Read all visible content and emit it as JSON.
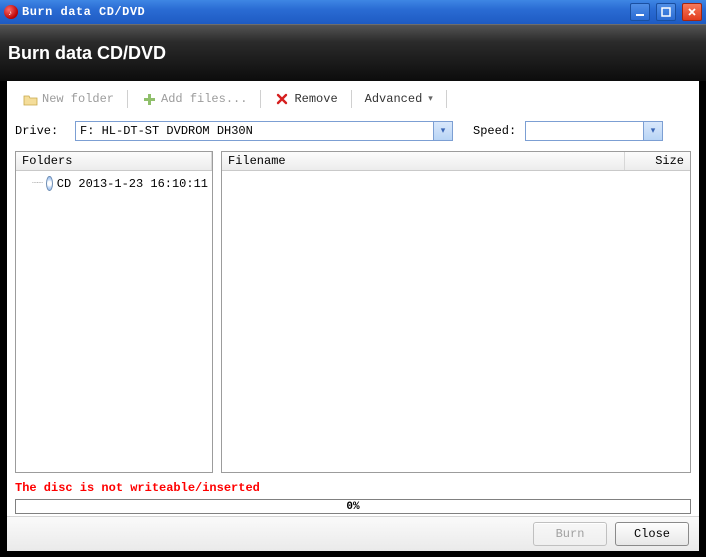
{
  "title": "Burn data CD/DVD",
  "header": {
    "heading": "Burn data CD/DVD"
  },
  "toolbar": {
    "new_folder": "New folder",
    "add_files": "Add files...",
    "remove": "Remove",
    "advanced": "Advanced"
  },
  "drives": {
    "drive_label": "Drive:",
    "drive_value": "F: HL-DT-ST DVDROM DH30N",
    "speed_label": "Speed:",
    "speed_value": ""
  },
  "folders_pane": {
    "header": "Folders",
    "items": [
      {
        "label": "CD 2013-1-23 16:10:11"
      }
    ]
  },
  "files_pane": {
    "col_filename": "Filename",
    "col_size": "Size",
    "rows": []
  },
  "status": {
    "message": "The disc is not writeable/inserted",
    "progress_text": "0%"
  },
  "footer": {
    "burn": "Burn",
    "close": "Close"
  }
}
